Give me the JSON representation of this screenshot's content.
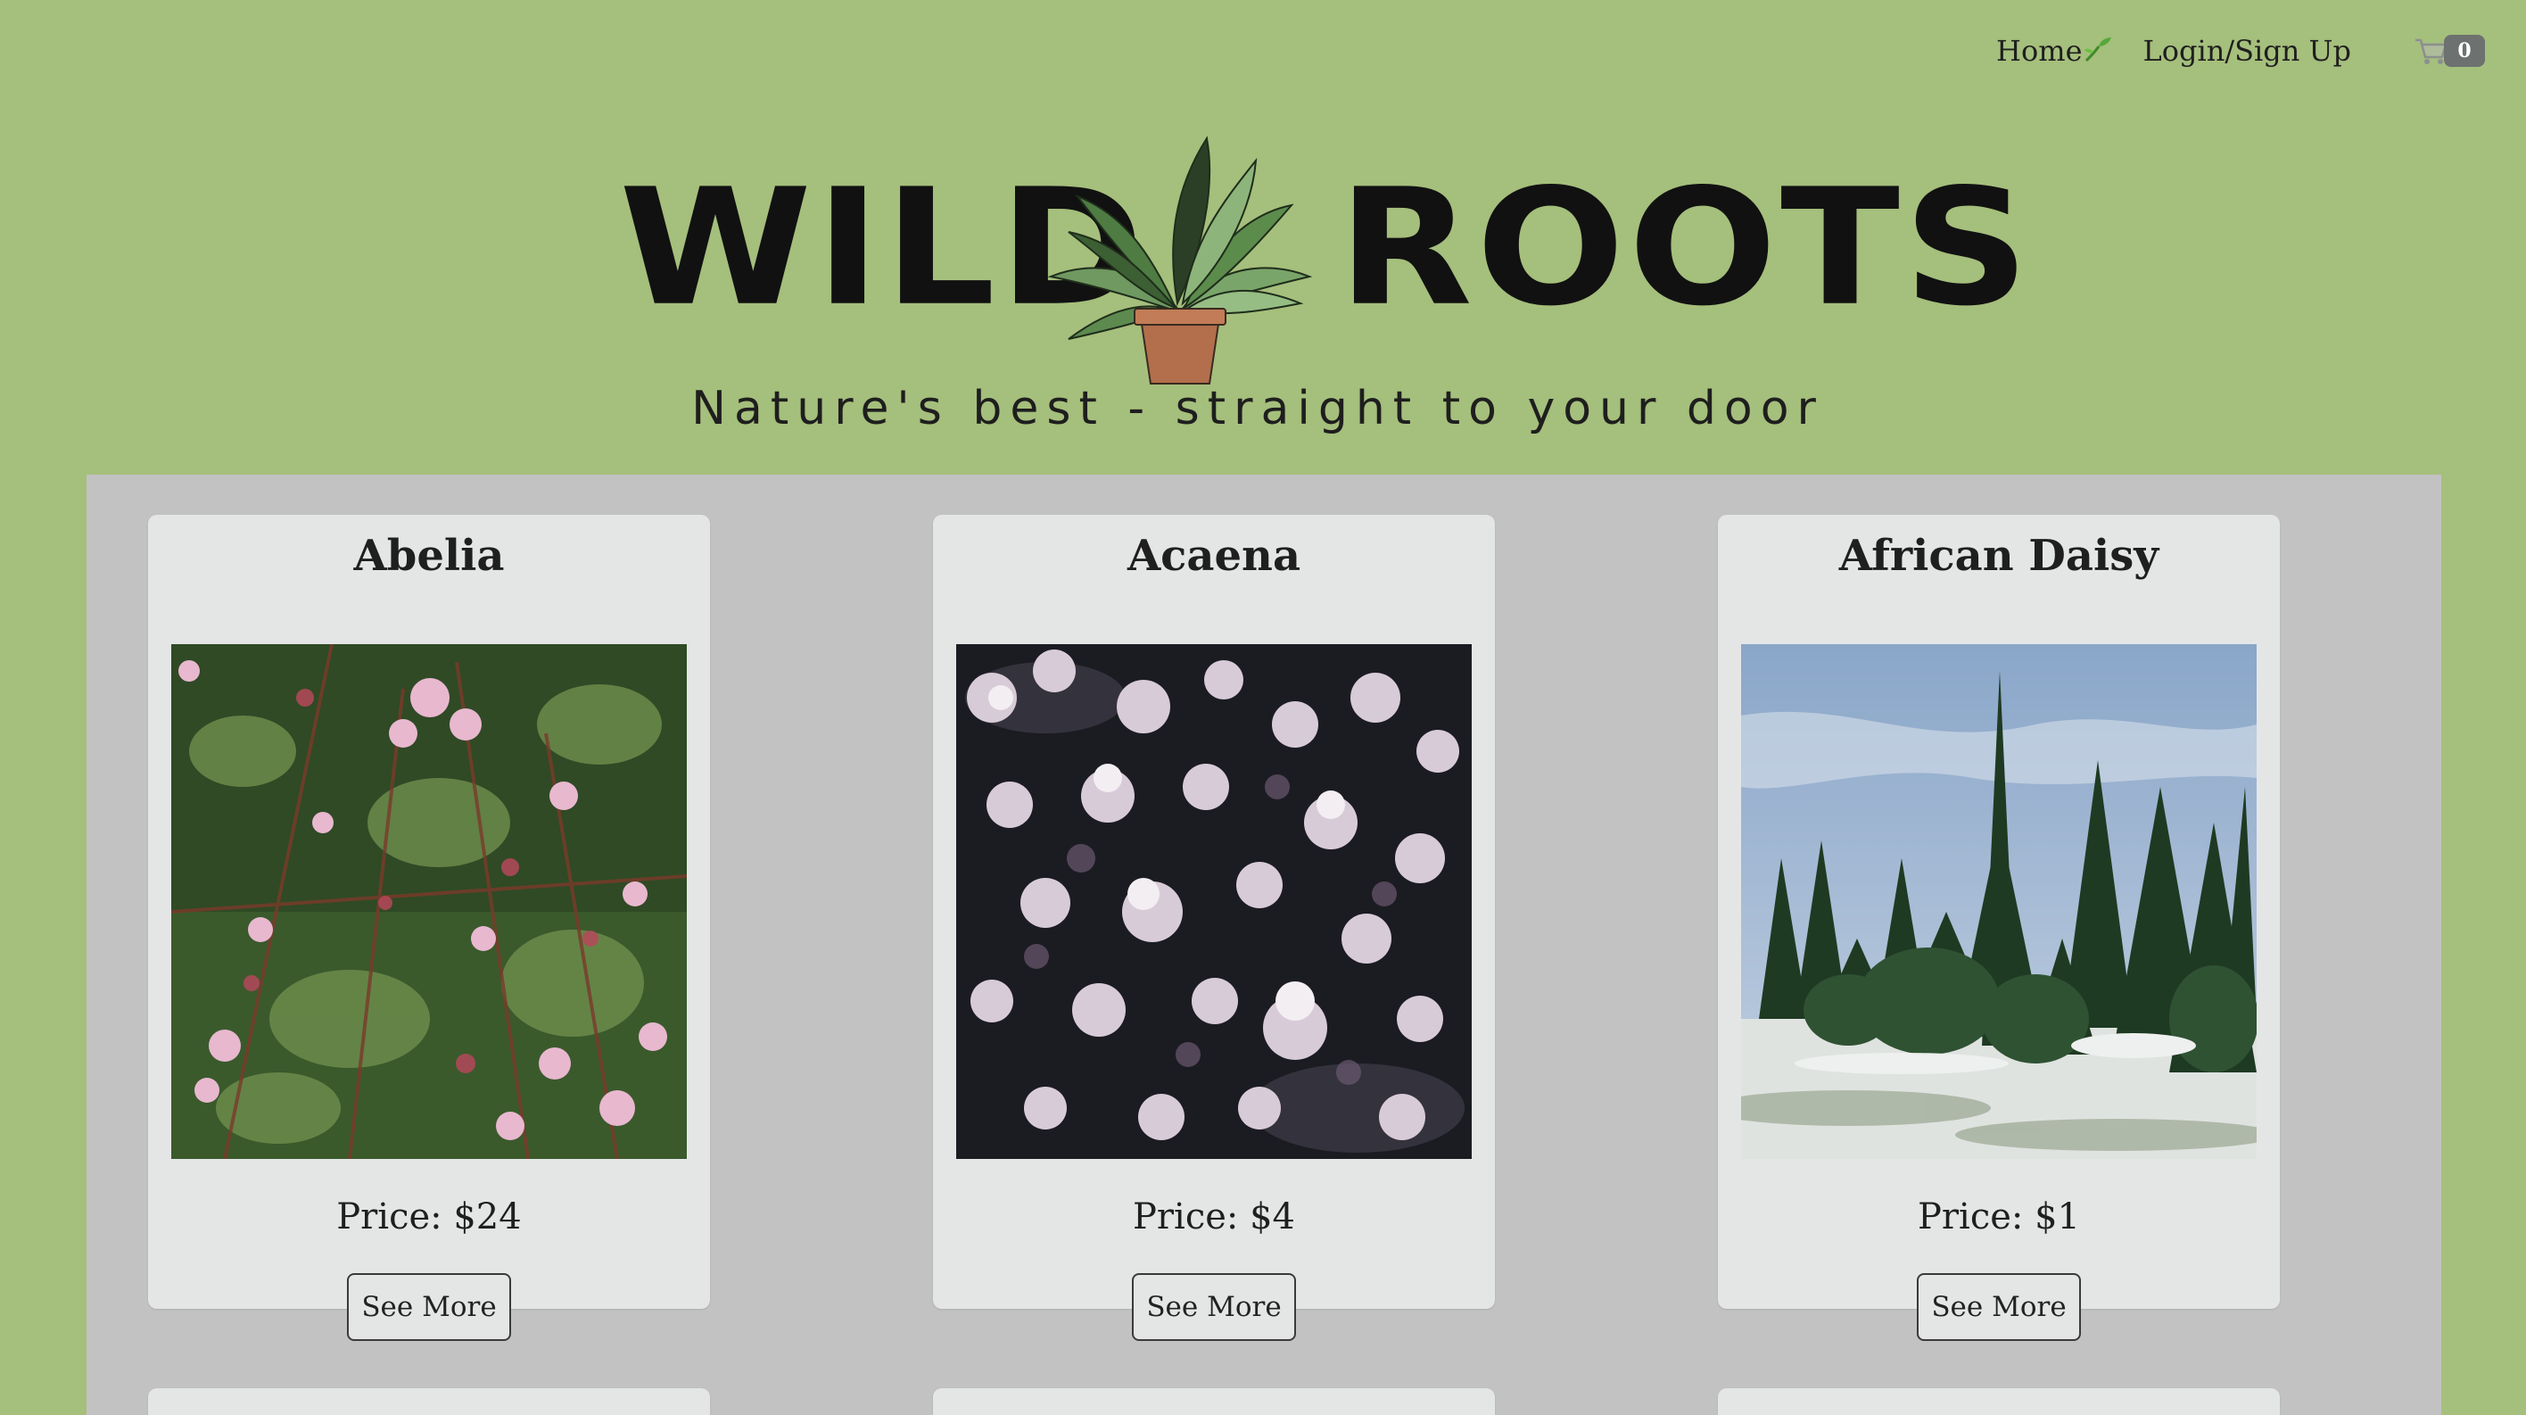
{
  "nav": {
    "home_label": "Home",
    "login_label": "Login/Sign Up",
    "cart_count": "0"
  },
  "brand": {
    "name_left": "WILD",
    "name_right": "ROOTS",
    "tagline": "Nature's best - straight to your door"
  },
  "products": [
    {
      "name": "Abelia",
      "price": "Price: $24",
      "button": "See More"
    },
    {
      "name": "Acaena",
      "price": "Price: $4",
      "button": "See More"
    },
    {
      "name": "African Daisy",
      "price": "Price: $1",
      "button": "See More"
    }
  ],
  "colors": {
    "page_bg": "#a5bf7c",
    "panel_bg": "#c2c2c2",
    "card_bg": "#e4e6e6",
    "badge_bg": "#6d7170"
  }
}
